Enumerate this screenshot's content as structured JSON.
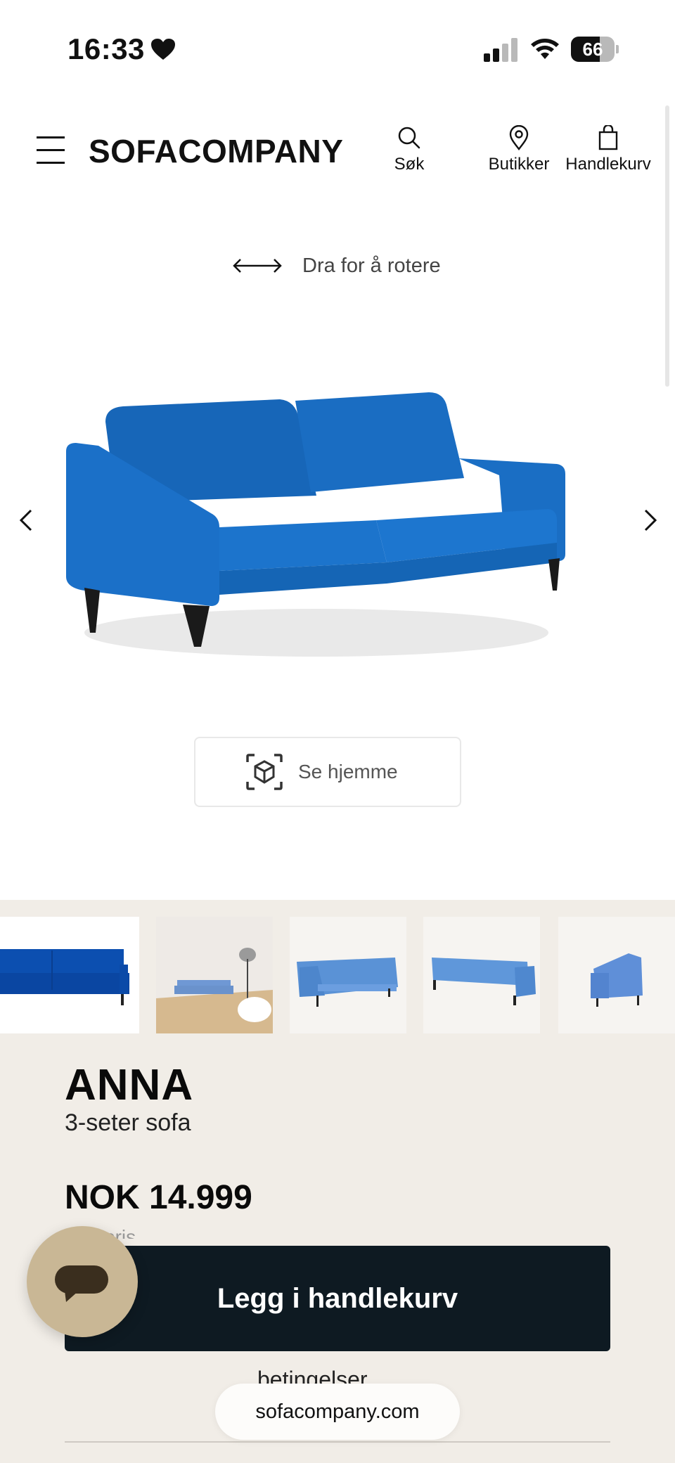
{
  "status_bar": {
    "time": "16:33",
    "battery_level": 66,
    "battery_text": "66"
  },
  "header": {
    "logo": "SOFACOMPANY",
    "nav": {
      "search": "Søk",
      "stores": "Butikker",
      "cart": "Handlekurv"
    }
  },
  "viewer": {
    "rotate_hint": "Dra for å rotere",
    "ar_button": "Se hjemme"
  },
  "colors": {
    "sofa_blue": "#1d6fc4",
    "cta_background": "#0e1a22",
    "section_background": "#f1ede7",
    "chat_button": "#c9b795"
  },
  "thumbnails": [
    {
      "label": "front-view"
    },
    {
      "label": "room-view"
    },
    {
      "label": "angle-view"
    },
    {
      "label": "back-view"
    },
    {
      "label": "side-view"
    }
  ],
  "product": {
    "name": "ANNA",
    "subtitle": "3-seter sofa",
    "price": "NOK 14.999",
    "partial_line": "Sluttpris",
    "add_to_cart": "Legg i handlekurv",
    "partial_terms": "betingelser"
  },
  "browser": {
    "url": "sofacompany.com"
  }
}
